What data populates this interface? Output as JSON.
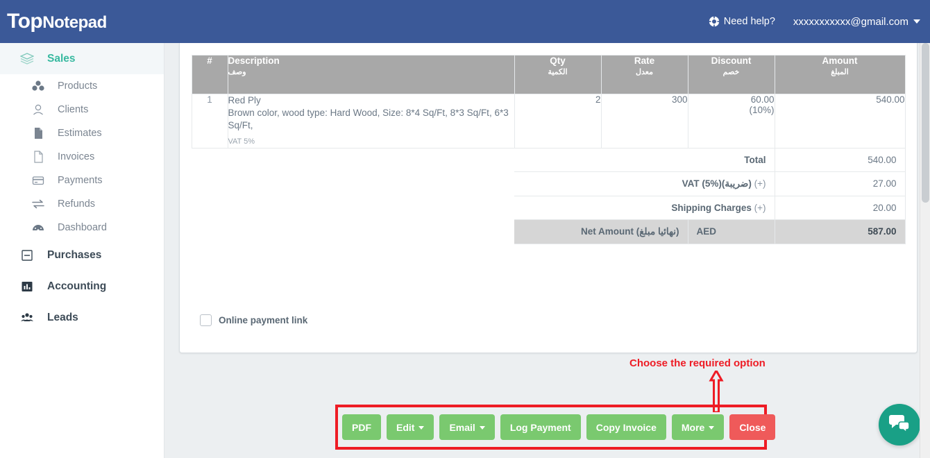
{
  "topbar": {
    "brand_top": "Top",
    "brand_note": "Notepad",
    "help_label": "Need help?",
    "help_icon": "life-ring-icon",
    "user_email": "xxxxxxxxxxx@gmail.com",
    "bg_color": "#3b5998"
  },
  "sidebar": {
    "groups": [
      {
        "label": "Sales",
        "icon": "layers-icon",
        "active": true
      },
      {
        "label": "Purchases",
        "icon": "minus-square-icon",
        "active": false
      },
      {
        "label": "Accounting",
        "icon": "bar-chart-icon",
        "active": false
      },
      {
        "label": "Leads",
        "icon": "people-icon",
        "active": false
      }
    ],
    "sales_items": [
      {
        "label": "Products",
        "icon": "cubes-icon"
      },
      {
        "label": "Clients",
        "icon": "user-icon"
      },
      {
        "label": "Estimates",
        "icon": "file-filled-icon"
      },
      {
        "label": "Invoices",
        "icon": "file-outline-icon"
      },
      {
        "label": "Payments",
        "icon": "credit-card-icon"
      },
      {
        "label": "Refunds",
        "icon": "exchange-icon"
      },
      {
        "label": "Dashboard",
        "icon": "dashboard-icon"
      }
    ],
    "active_color": "#38b9a0"
  },
  "invoice": {
    "columns": [
      {
        "en": "#",
        "ar": ""
      },
      {
        "en": "Description",
        "ar": "وصف"
      },
      {
        "en": "Qty",
        "ar": "الكمية"
      },
      {
        "en": "Rate",
        "ar": "معدل"
      },
      {
        "en": "Discount",
        "ar": "خصم"
      },
      {
        "en": "Amount",
        "ar": "المبلغ"
      }
    ],
    "rows": [
      {
        "num": "1",
        "title": "Red Ply",
        "description": "Brown color, wood type: Hard Wood, Size: 8*4 Sq/Ft, 8*3 Sq/Ft, 6*3 Sq/Ft,",
        "vat_note": "VAT 5%",
        "qty": "2",
        "rate": "300",
        "discount": "60.00",
        "discount_pct": "(10%)",
        "amount": "540.00"
      }
    ],
    "summary": [
      {
        "label": "Total",
        "sign": "",
        "value": "540.00"
      },
      {
        "label": "VAT (5%)(ضريبة)",
        "sign": "(+)",
        "value": "27.00"
      },
      {
        "label": "Shipping Charges",
        "sign": "(+)",
        "value": "20.00"
      }
    ],
    "net": {
      "label": "Net Amount (نهائيا مبلغ)",
      "currency": "AED",
      "value": "587.00"
    },
    "header_bg": "#a8a8a8",
    "net_bg": "#d6d6d6"
  },
  "online_payment": {
    "label": "Online payment link",
    "checked": false
  },
  "annotation": {
    "text": "Choose the required option",
    "color": "#ee1c25"
  },
  "actions": {
    "buttons": [
      {
        "label": "PDF",
        "caret": false,
        "style": "primary"
      },
      {
        "label": "Edit",
        "caret": true,
        "style": "primary"
      },
      {
        "label": "Email",
        "caret": true,
        "style": "primary"
      },
      {
        "label": "Log Payment",
        "caret": false,
        "style": "primary"
      },
      {
        "label": "Copy Invoice",
        "caret": false,
        "style": "primary"
      },
      {
        "label": "More",
        "caret": true,
        "style": "primary"
      },
      {
        "label": "Close",
        "caret": false,
        "style": "danger"
      }
    ],
    "primary_color": "#7ac96f",
    "danger_color": "#ef5a5a"
  },
  "chat_widget": {
    "icon": "chat-bubbles-icon",
    "color": "#19a086"
  }
}
